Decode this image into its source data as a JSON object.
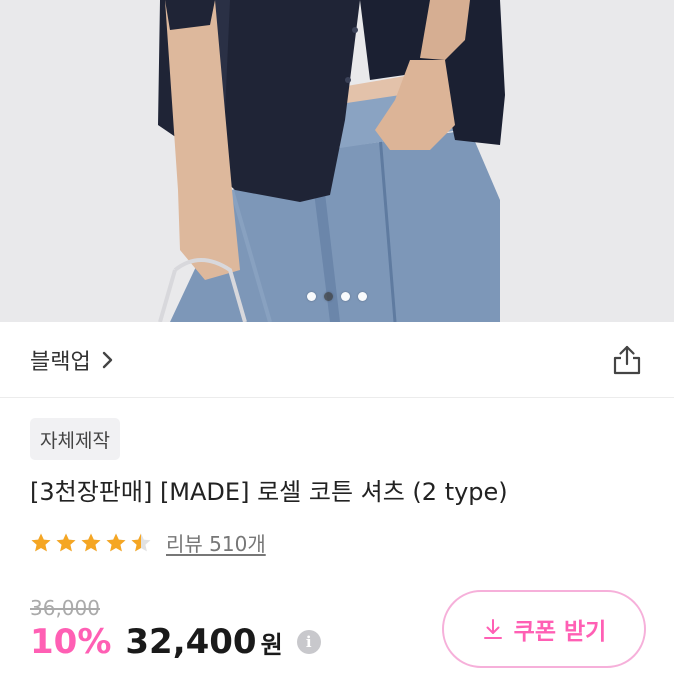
{
  "gallery": {
    "slide_count": 4,
    "active_index": 1
  },
  "brand": {
    "name": "블랙업",
    "chevron_icon": "chevron-right-icon",
    "share_icon": "share-icon"
  },
  "product": {
    "tag": "자체제작",
    "title": "[3천장판매] [MADE] 로셀 코튼 셔츠 (2 type)",
    "rating": 4.5,
    "rating_max": 5,
    "review_label": "리뷰 510개",
    "original_price": "36,000",
    "discount": "10%",
    "price": "32,400",
    "currency": "원",
    "info_icon_glyph": "i"
  },
  "coupon": {
    "label": "쿠폰 받기",
    "icon": "download-icon"
  },
  "colors": {
    "accent_pink": "#ff5fb4",
    "coupon_border": "#f6b0da",
    "star": "#f5a623"
  }
}
